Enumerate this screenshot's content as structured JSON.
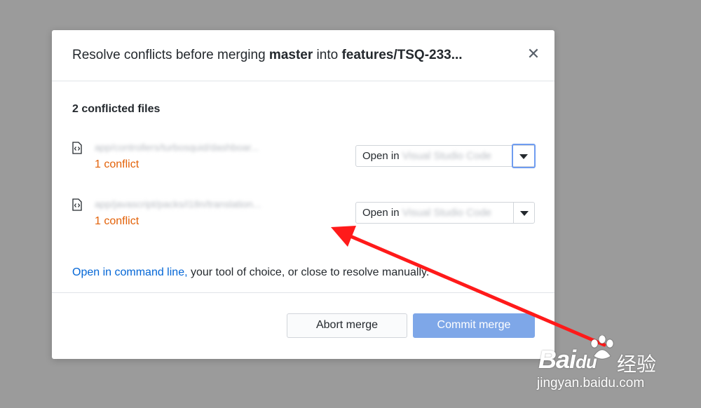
{
  "dialog": {
    "title_prefix": "Resolve conflicts before merging ",
    "source_branch": "master",
    "title_middle": " into ",
    "target_branch": "features/TSQ-233...",
    "close_label": "✕"
  },
  "files": {
    "heading": "2 conflicted files",
    "items": [
      {
        "path": "app/controllers/turbosquid/dashboar...",
        "conflict_label": "1 conflict",
        "open_prefix": "Open in ",
        "app_name": "Visual Studio Code",
        "icon": "code-file-icon"
      },
      {
        "path": "app/javascript/packs/i18n/translation...",
        "conflict_label": "1 conflict",
        "open_prefix": "Open in ",
        "app_name": "Visual Studio Code",
        "icon": "code-file-icon"
      }
    ]
  },
  "hint": {
    "link": "Open in command line,",
    "rest": " your tool of choice, or close to resolve manually."
  },
  "buttons": {
    "abort": "Abort merge",
    "commit": "Commit merge"
  },
  "watermark": {
    "brand": "Bai",
    "brand_suffix": "du",
    "chinese": "经验",
    "url": "jingyan.baidu.com"
  },
  "colors": {
    "conflict": "#e36209",
    "link": "#0366d6",
    "commit_button": "#7ea7e8",
    "annotation_arrow": "#ff0000"
  }
}
